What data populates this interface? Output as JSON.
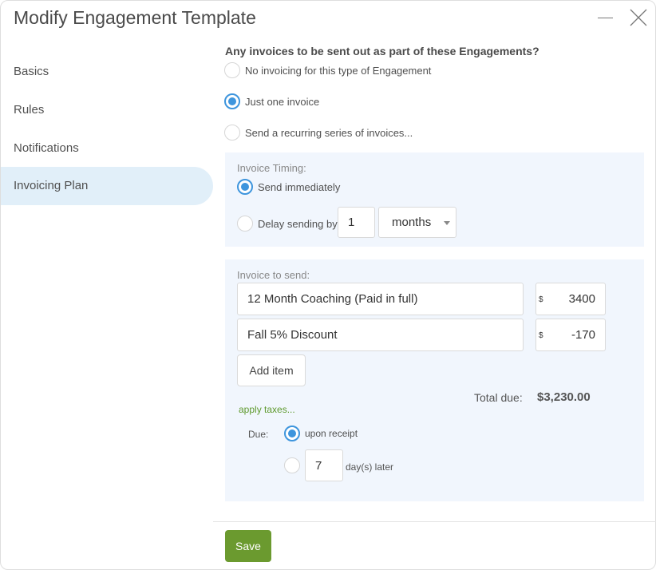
{
  "window": {
    "title": "Modify Engagement Template",
    "minimize_icon": "minimize-icon",
    "close_icon": "close-icon"
  },
  "sidebar": {
    "items": [
      {
        "label": "Basics",
        "active": false
      },
      {
        "label": "Rules",
        "active": false
      },
      {
        "label": "Notifications",
        "active": false
      },
      {
        "label": "Invoicing Plan",
        "active": true
      }
    ]
  },
  "invoicing": {
    "question": "Any invoices to be sent out as part of these Engagements?",
    "options": [
      {
        "label": "No invoicing for this type of Engagement",
        "selected": false
      },
      {
        "label": "Just one invoice",
        "selected": true
      },
      {
        "label": "Send a recurring series of invoices...",
        "selected": false
      }
    ]
  },
  "timing": {
    "label": "Invoice Timing:",
    "send_immediately": {
      "label": "Send immediately",
      "selected": true
    },
    "delay": {
      "label": "Delay sending by",
      "selected": false,
      "amount": "1",
      "unit": "months"
    }
  },
  "invoice": {
    "label": "Invoice to send:",
    "items": [
      {
        "description": "12 Month Coaching (Paid in full)",
        "currency": "$",
        "amount": "3400"
      },
      {
        "description": "Fall 5% Discount",
        "currency": "$",
        "amount": "-170"
      }
    ],
    "add_item_label": "Add item",
    "total_label": "Total due:",
    "total_value": "$3,230.00",
    "apply_taxes_label": "apply taxes...",
    "due": {
      "label": "Due:",
      "upon_receipt": {
        "label": "upon receipt",
        "selected": true
      },
      "later": {
        "days": "7",
        "label": "day(s) later",
        "selected": false
      }
    }
  },
  "footer": {
    "save_label": "Save"
  },
  "colors": {
    "accent_blue": "#3e95dd",
    "save_green": "#6b9a2f",
    "link_green": "#5f9a2e",
    "active_nav_bg": "#e1eff9",
    "panel_bg": "#f1f6fd"
  }
}
